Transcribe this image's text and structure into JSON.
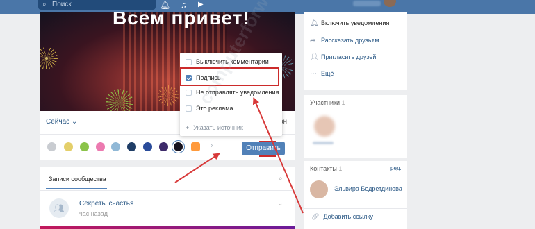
{
  "colors": {
    "topbar": "#4a76a8",
    "accent": "#5181b8",
    "highlight": "#cc2b2b",
    "link": "#2a5885"
  },
  "topbar": {
    "search_placeholder": "Поиск",
    "search_icon": "search-icon",
    "icons": [
      "bell-icon",
      "music-icon",
      "play-icon"
    ]
  },
  "banner": {
    "title": "Всем привет!"
  },
  "composer": {
    "time_label": "Сейчас",
    "time_suffix": "он",
    "send_label": "Отправить",
    "swatches": [
      "#c9ccd1",
      "#e4cf6a",
      "#8bc34a",
      "#ec7ab0",
      "#90b8d6",
      "#1f3d66",
      "#2a4c9a",
      "#3d2a6a",
      "#17131f",
      "#ff9a3c"
    ]
  },
  "menu": {
    "items": [
      {
        "label": "Выключить комментарии",
        "checked": false
      },
      {
        "label": "Подпись",
        "checked": true
      },
      {
        "label": "Не отправлять уведомления",
        "checked": false
      },
      {
        "label": "Это реклама",
        "checked": false
      }
    ],
    "source_label": "Указать источник"
  },
  "records": {
    "tab_label": "Записи сообщества",
    "post_author": "Секреты счастья",
    "post_time": "час назад"
  },
  "right_panel": {
    "items": [
      {
        "label": "Включить уведомления",
        "icon": "bell-icon"
      },
      {
        "label": "Рассказать друзьям",
        "icon": "share-icon"
      },
      {
        "label": "Пригласить друзей",
        "icon": "add-user-icon"
      },
      {
        "label": "Ещё",
        "icon": "more-icon"
      }
    ]
  },
  "members": {
    "title": "Участники",
    "count": "1"
  },
  "contacts": {
    "title": "Контакты",
    "count": "1",
    "edit_label": "ред.",
    "contact_name": "Эльвира Бедретдинова",
    "add_link_label": "Добавить ссылку"
  },
  "watermark": "computerforwhat.ru"
}
